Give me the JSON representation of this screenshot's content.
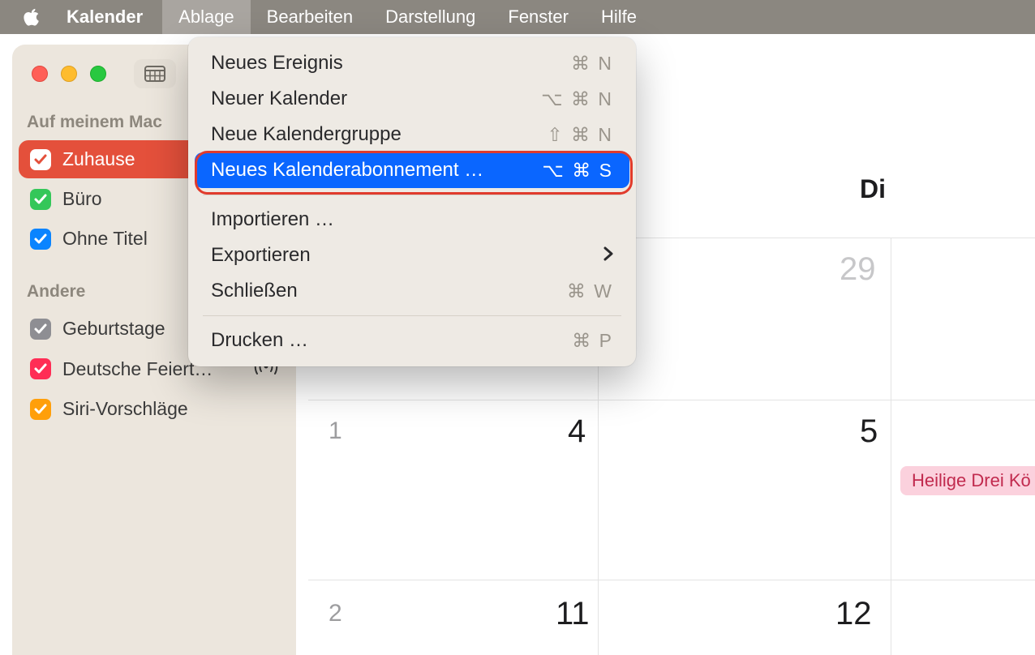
{
  "menubar": {
    "app_name": "Kalender",
    "items": [
      "Ablage",
      "Bearbeiten",
      "Darstellung",
      "Fenster",
      "Hilfe"
    ],
    "active_index": 0
  },
  "sidebar": {
    "section1_title": "Auf meinem Mac",
    "section2_title": "Andere",
    "calendars_local": [
      {
        "label": "Zuhause",
        "color": "#e4503b",
        "checked": true,
        "selected": true
      },
      {
        "label": "Büro",
        "color": "#34c759",
        "checked": true,
        "selected": false
      },
      {
        "label": "Ohne Titel",
        "color": "#0a84ff",
        "checked": true,
        "selected": false
      }
    ],
    "calendars_other": [
      {
        "label": "Geburtstage",
        "color": "#8e8e93",
        "checked": true
      },
      {
        "label": "Deutsche Feiert…",
        "color": "#ff2d55",
        "checked": true,
        "broadcasting": true
      },
      {
        "label": "Siri-Vorschläge",
        "color": "#ff9f0a",
        "checked": true
      }
    ]
  },
  "dropdown": {
    "items": [
      {
        "label": "Neues Ereignis",
        "shortcut": "⌘ N"
      },
      {
        "label": "Neuer Kalender",
        "shortcut": "⌥ ⌘ N"
      },
      {
        "label": "Neue Kalendergruppe",
        "shortcut": "⇧ ⌘ N"
      },
      {
        "label": "Neues Kalenderabonnement …",
        "shortcut": "⌥ ⌘ S",
        "highlight": true
      },
      {
        "divider": true
      },
      {
        "label": "Importieren …"
      },
      {
        "label": "Exportieren",
        "submenu": true
      },
      {
        "label": "Schließen",
        "shortcut": "⌘ W"
      },
      {
        "divider": true
      },
      {
        "label": "Drucken …",
        "shortcut": "⌘ P"
      }
    ]
  },
  "calendar": {
    "weekday_visible": "Di",
    "days": {
      "prev_29": "29",
      "week_small_1": "1",
      "d4": "4",
      "d5": "5",
      "week_small_2": "2",
      "d11": "11",
      "d12": "12"
    },
    "event_label": "Heilige Drei Kö"
  }
}
